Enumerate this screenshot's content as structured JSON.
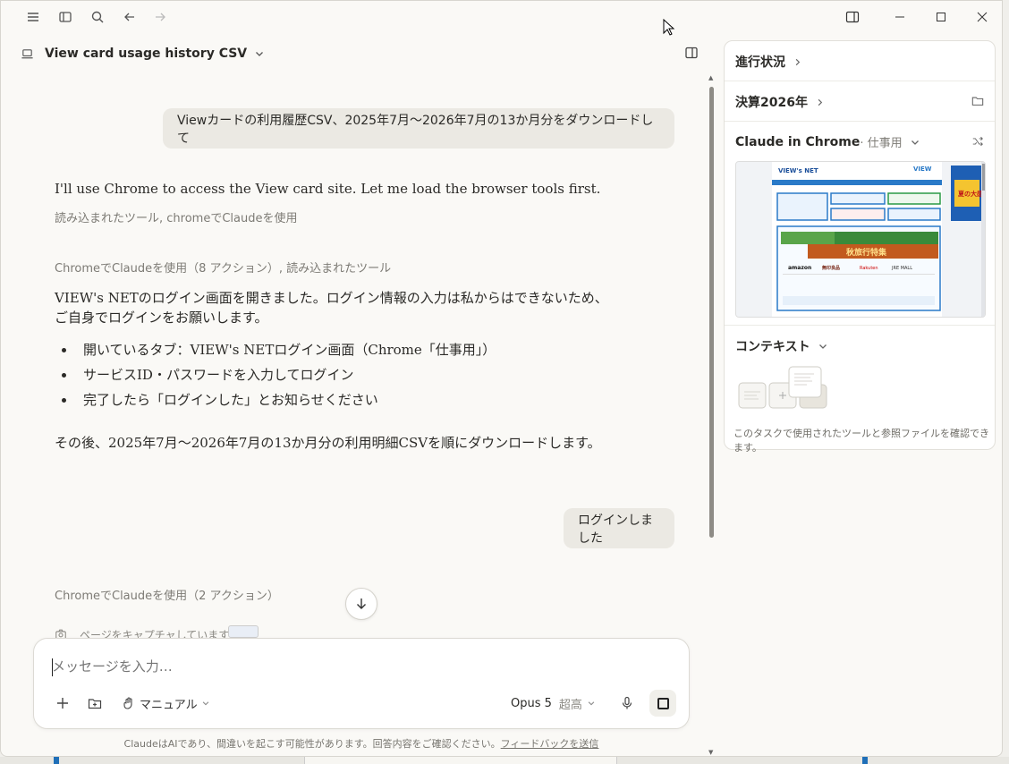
{
  "chat": {
    "title": "View card usage history CSV"
  },
  "messages": {
    "user1": "Viewカードの利用履歴CSV、2025年7月〜2026年7月の13か月分をダウンロードして",
    "assistant1": "I'll use Chrome to access the View card site. Let me load the browser tools first.",
    "tools1": "読み込まれたツール, chromeでClaudeを使用",
    "tools2": "ChromeでClaudeを使用（8 アクション）, 読み込まれたツール",
    "assistant2_line1": "VIEW's NETのログイン画面を開きました。ログイン情報の入力は私からはできないため、",
    "assistant2_line2": "ご自身でログインをお願いします。",
    "bullets": [
      "開いているタブ：VIEW's NETログイン画面（Chrome「仕事用」）",
      "サービスID・パスワードを入力してログイン",
      "完了したら「ログインした」とお知らせください"
    ],
    "assistant3": "その後、2025年7月〜2026年7月の13か月分の利用明細CSVを順にダウンロードします。",
    "user2": "ログインしました",
    "tools3": "ChromeでClaudeを使用（2 アクション）",
    "capturing": "ページをキャプチャしています"
  },
  "composer": {
    "placeholder": "メッセージを入力…",
    "mode": "マニュアル",
    "model": "Opus 5",
    "effort": "超高"
  },
  "disclaimer": {
    "text": "ClaudeはAIであり、間違いを起こす可能性があります。回答内容をご確認ください。",
    "link": "フィードバックを送信"
  },
  "side_panel": {
    "progress": "進行状況",
    "project": "決算2026年",
    "browser_label": "Claude in Chrome",
    "browser_profile": " · 仕事用",
    "context": "コンテキスト",
    "context_desc": "このタスクで使用されたツールと参照ファイルを確認できます。"
  },
  "thumbnail": {
    "site_logo": "VIEW's NET",
    "banner1": "秋旅行特集",
    "ad": "夏の大感謝祭",
    "brands": [
      "amazon",
      "無印良品",
      "Rakuten",
      "JRE MALL"
    ]
  }
}
